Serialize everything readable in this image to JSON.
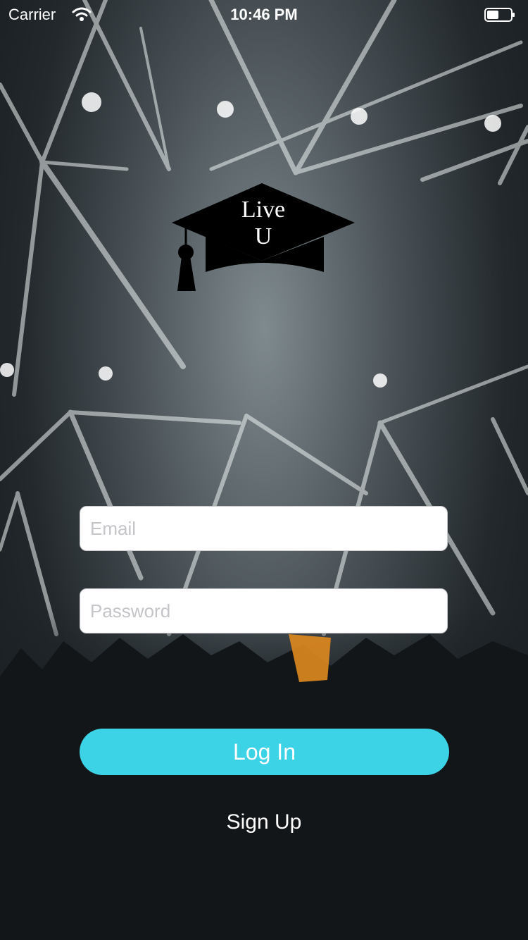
{
  "status_bar": {
    "carrier": "Carrier",
    "time": "10:46 PM",
    "icons": [
      "wifi-icon",
      "battery-icon"
    ]
  },
  "logo": {
    "line1": "Live",
    "line2": "U",
    "icon": "graduation-cap-icon"
  },
  "form": {
    "email_placeholder": "Email",
    "password_placeholder": "Password",
    "login_label": "Log In",
    "signup_label": "Sign Up"
  },
  "colors": {
    "accent": "#3dd3e6",
    "text_light": "#ffffff",
    "placeholder": "#c4c4c9"
  }
}
